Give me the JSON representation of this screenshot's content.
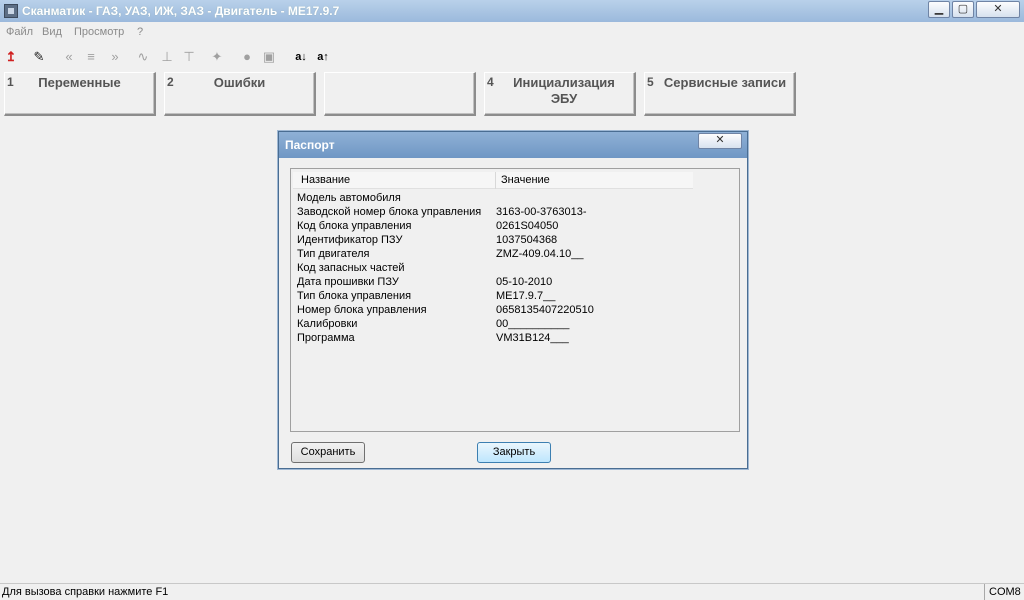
{
  "window": {
    "title": "Сканматик - ГАЗ, УАЗ, ИЖ, ЗАЗ - Двигатель - ME17.9.7",
    "min_icon": "▁",
    "max_icon": "▢",
    "close_icon": "✕"
  },
  "menu": [
    "Файл",
    "Вид",
    "Просмотр",
    "?"
  ],
  "toolbar": {
    "icons": [
      {
        "name": "upload-icon",
        "glyph": "↥"
      },
      {
        "name": "notepad-icon",
        "glyph": "✎"
      },
      {
        "name": "rewind-icon",
        "glyph": "«"
      },
      {
        "name": "list-icon",
        "glyph": "≡"
      },
      {
        "name": "forward-icon",
        "glyph": "»"
      },
      {
        "name": "wave-icon",
        "glyph": "∿"
      },
      {
        "name": "step-up-icon",
        "glyph": "⊥"
      },
      {
        "name": "step-down-icon",
        "glyph": "⊤"
      },
      {
        "name": "pin-icon",
        "glyph": "✦"
      },
      {
        "name": "record-icon",
        "glyph": "●"
      },
      {
        "name": "save-disk-icon",
        "glyph": "▣"
      }
    ],
    "sort_down": "a↓",
    "sort_up": "a↑"
  },
  "tabs": [
    {
      "num": "1",
      "label": "Переменные"
    },
    {
      "num": "2",
      "label": "Ошибки"
    },
    {
      "num": "",
      "label": ""
    },
    {
      "num": "4",
      "label": "Инициализация ЭБУ"
    },
    {
      "num": "5",
      "label": "Сервисные записи"
    }
  ],
  "dialog": {
    "title": "Паспорт",
    "close_icon": "✕",
    "col_name": "Название",
    "col_value": "Значение",
    "rows": [
      {
        "k": "Модель автомобиля",
        "v": ""
      },
      {
        "k": "Заводской номер блока управления",
        "v": "3163-00-3763013-"
      },
      {
        "k": "Код блока управления",
        "v": "0261S04050"
      },
      {
        "k": "Идентификатор ПЗУ",
        "v": "1037504368"
      },
      {
        "k": "Тип двигателя",
        "v": "ZMZ-409.04.10__"
      },
      {
        "k": "Код запасных частей",
        "v": ""
      },
      {
        "k": "Дата прошивки ПЗУ",
        "v": "05-10-2010"
      },
      {
        "k": "Тип блока управления",
        "v": "ME17.9.7__"
      },
      {
        "k": "Номер блока управления",
        "v": "0658135407220510"
      },
      {
        "k": "Калибровки",
        "v": "00__________"
      },
      {
        "k": "Программа",
        "v": "VM31B124___"
      }
    ],
    "save_label": "Сохранить",
    "close_label": "Закрыть"
  },
  "status": {
    "help": "Для вызова справки нажмите F1",
    "port": "COM8"
  }
}
